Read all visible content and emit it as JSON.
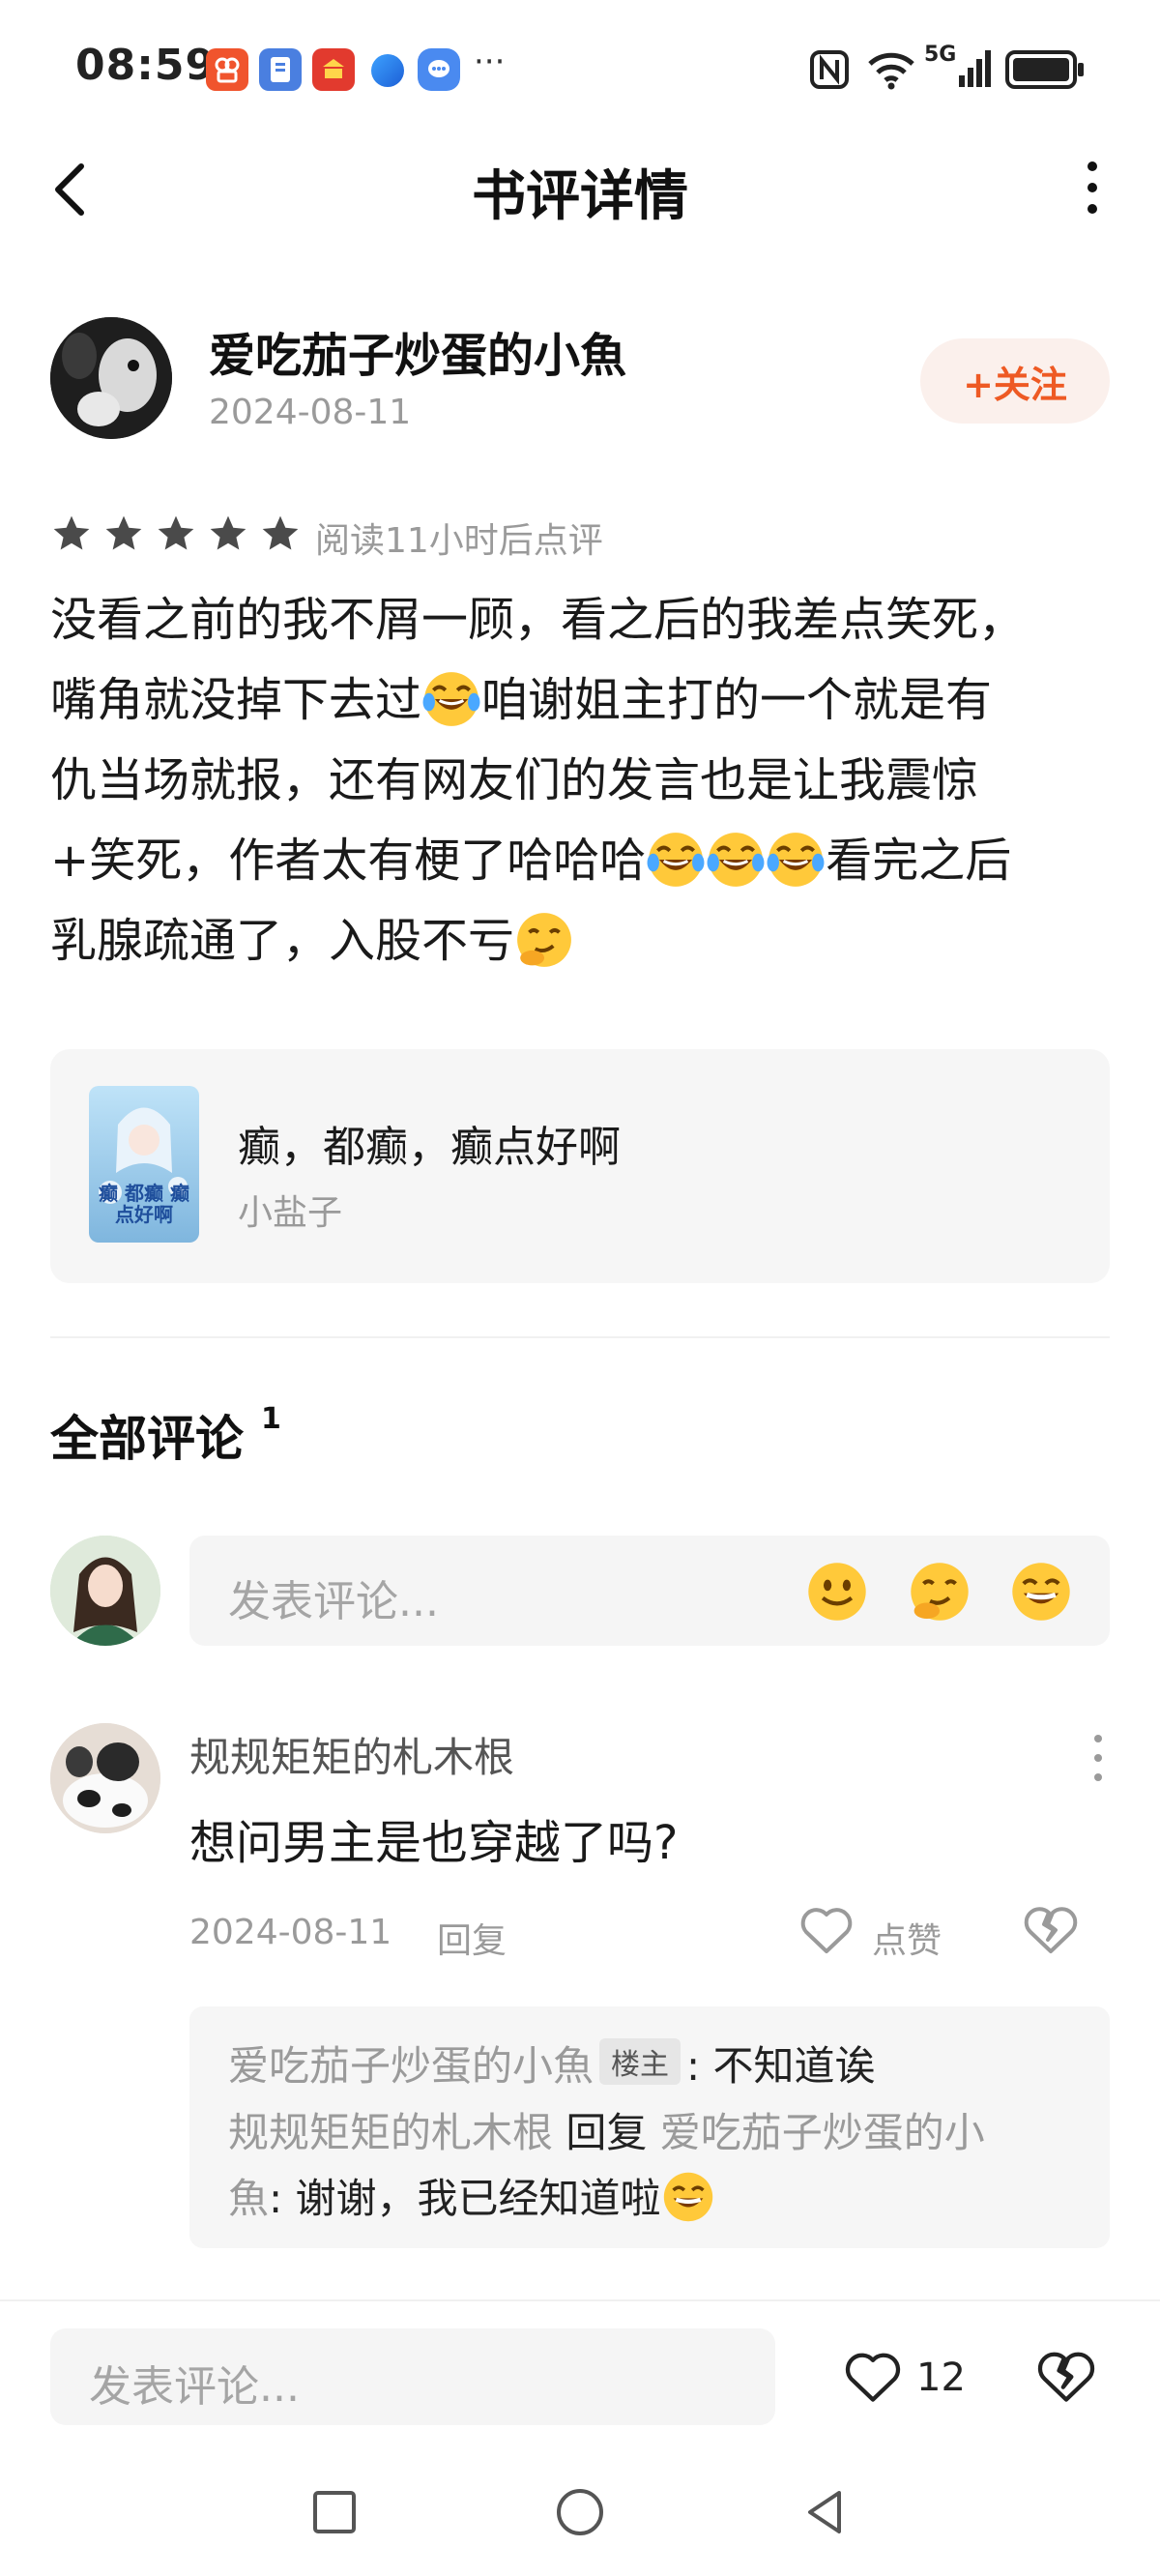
{
  "status_bar": {
    "time": "08:59",
    "more": "···",
    "network": "5G"
  },
  "header": {
    "title": "书评详情"
  },
  "author": {
    "name": "爱吃茄子炒蛋的小魚",
    "date": "2024-08-11",
    "follow_label": "+关注"
  },
  "rating": {
    "stars": 5,
    "note": "阅读11小时后点评"
  },
  "review": {
    "line1": "没看之前的我不屑一顾，看之后的我差点笑死，",
    "line2a": "嘴角就没掉下去过",
    "line2b": "咱谢姐主打的一个就是有",
    "line3": "仇当场就报，还有网友们的发言也是让我震惊",
    "line4a": "+笑死，作者太有梗了哈哈哈",
    "line4b": "看完之后",
    "line5": "乳腺疏通了，入股不亏"
  },
  "book": {
    "title": "癫，都癫，癫点好啊",
    "author": "小盐子",
    "cover_text": "癫 都癫 癫点好啊"
  },
  "comments": {
    "title": "全部评论",
    "count": "1",
    "input_placeholder": "发表评论...",
    "items": [
      {
        "name": "规规矩矩的札木根",
        "text": "想问男主是也穿越了吗?",
        "date": "2024-08-11",
        "reply_label": "回复",
        "like_label": "点赞",
        "replies": [
          {
            "from": "爱吃茄子炒蛋的小魚",
            "tag": "楼主",
            "text": ": 不知道诶"
          },
          {
            "from": "规规矩矩的札木根",
            "verb": "回复",
            "to_part1": "爱吃茄子炒蛋的小",
            "to_part2": "魚",
            "text": ": 谢谢，我已经知道啦"
          }
        ]
      }
    ]
  },
  "bottom_bar": {
    "placeholder": "发表评论...",
    "like_count": "12"
  },
  "colors": {
    "accent": "#ee5a24",
    "star": "#4a4a4a",
    "muted": "#9a9a9a",
    "card_bg": "#f6f6f6"
  }
}
